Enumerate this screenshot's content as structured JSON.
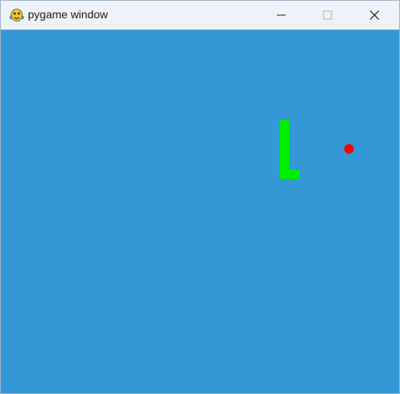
{
  "window": {
    "title": "pygame window",
    "app_icon": "python-snake-icon",
    "controls": {
      "minimize_icon": "minimize-icon",
      "maximize_icon": "maximize-icon",
      "close_icon": "close-icon"
    }
  },
  "game": {
    "background_color": "#3498d6",
    "snake": {
      "color": "#00ee00",
      "shape": "L"
    },
    "food": {
      "color": "#ff0000"
    }
  }
}
